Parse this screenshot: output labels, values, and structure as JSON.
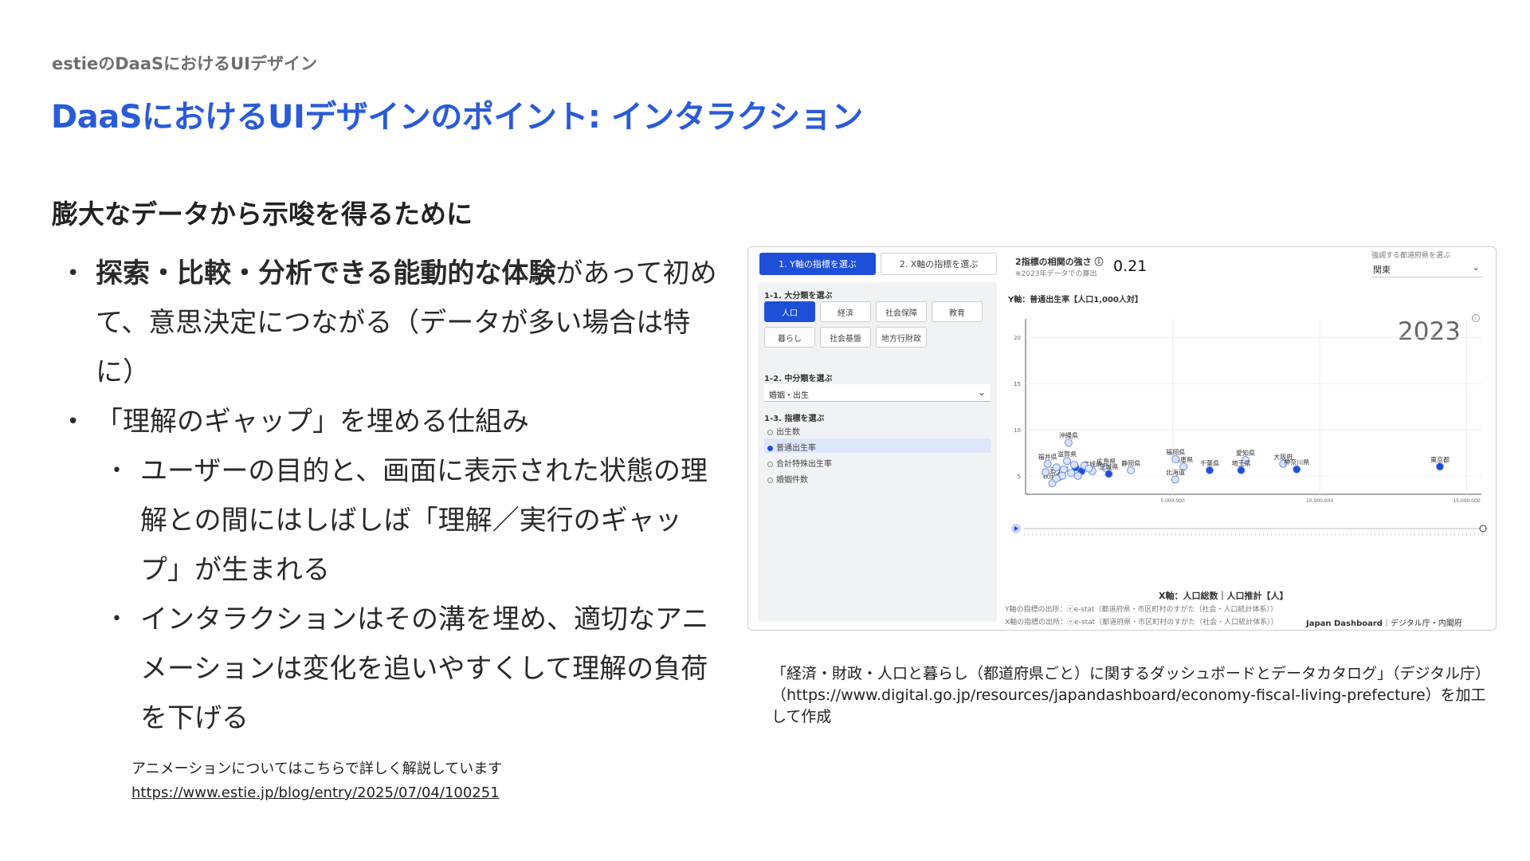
{
  "header": {
    "kicker": "estieのDaaSにおけるUIデザイン",
    "title": "DaaSにおけるUIデザインのポイント: インタラクション"
  },
  "section_heading": "膨大なデータから示唆を得るために",
  "bullets": {
    "b1_strong": "探索・比較・分析できる能動的な体験",
    "b1_rest": "があって初めて、意思決定につながる（データが多い場合は特に）",
    "b2": "「理解のギャップ」を埋める仕組み",
    "b2_1": "ユーザーの目的と、画面に表示された状態の理解との間にはしばしば「理解／実行のギャップ」が生まれる",
    "b2_2": "インタラクションはその溝を埋め、適切なアニメーションは変化を追いやすくして理解の負荷を下げる"
  },
  "note": {
    "text": "アニメーションについてはこちらで詳しく解説しています",
    "link": "https://www.estie.jp/blog/entry/2025/07/04/100251"
  },
  "dashboard": {
    "tab1": "1. Y軸の指標を選ぶ",
    "tab2": "2. X軸の指標を選ぶ",
    "corr_label": "2指標の相関の強さ ⓘ",
    "corr_note": "※2023年データでの算出",
    "corr_value": "0.21",
    "pref_label": "強調する都道府県を選ぶ",
    "pref_value": "関東",
    "s11": "1-1. 大分類を選ぶ",
    "chips": [
      "人口",
      "経済",
      "社会保障",
      "教育",
      "暮らし",
      "社会基盤",
      "地方行財政"
    ],
    "s12": "1-2. 中分類を選ぶ",
    "mid_value": "婚姻・出生",
    "s13": "1-3. 指標を選ぶ",
    "radios": [
      "出生数",
      "普通出生率",
      "合計特殊出生率",
      "婚姻件数"
    ],
    "y_title": "Y軸：普通出生率【人口1,000人対】",
    "year": "2023",
    "x_title": "X軸：人口総数｜人口推計【人】",
    "src_y": "Y軸の指標の出所：ⓔe-stat（都道府県・市区町村のすがた（社会・人口統計体系））",
    "src_x": "X軸の指標の出所：ⓔe-stat（都道府県・市区町村のすがた（社会・人口統計体系））",
    "brand_strong": "Japan Dashboard",
    "brand_rest": "｜デジタル庁・内閣府"
  },
  "chart_data": {
    "type": "scatter",
    "xlabel": "X軸：人口総数｜人口推計【人】",
    "ylabel": "Y軸：普通出生率【人口1,000人対】",
    "y_ticks": [
      "5",
      "10",
      "15",
      "20"
    ],
    "x_ticks": [
      "5,000,000",
      "10,000,000",
      "15,000,000"
    ],
    "ylim": [
      3,
      22
    ],
    "xlim": [
      0,
      15500000
    ],
    "points": [
      {
        "label": "沖縄県",
        "x": 1460000,
        "y": 8.6,
        "highlight": false
      },
      {
        "label": "福井県",
        "x": 750000,
        "y": 6.3,
        "highlight": false
      },
      {
        "label": "滋賀県",
        "x": 1410000,
        "y": 6.6,
        "highlight": false
      },
      {
        "label": "宮城県",
        "x": 2270000,
        "y": 5.5,
        "highlight": false
      },
      {
        "label": "静岡県",
        "x": 3580000,
        "y": 5.6,
        "highlight": false
      },
      {
        "label": "広島県",
        "x": 2740000,
        "y": 5.8,
        "highlight": false
      },
      {
        "label": "茨城県",
        "x": 2830000,
        "y": 5.2,
        "highlight": true
      },
      {
        "label": "岩手県",
        "x": 1160000,
        "y": 4.9,
        "highlight": false
      },
      {
        "label": "秋田県",
        "x": 910000,
        "y": 4.2,
        "highlight": false
      },
      {
        "label": "兵庫県",
        "x": 5370000,
        "y": 6.0,
        "highlight": false
      },
      {
        "label": "福岡県",
        "x": 5100000,
        "y": 6.8,
        "highlight": false
      },
      {
        "label": "北海道",
        "x": 5090000,
        "y": 4.6,
        "highlight": false
      },
      {
        "label": "千葉県",
        "x": 6260000,
        "y": 5.6,
        "highlight": true
      },
      {
        "label": "愛知県",
        "x": 7480000,
        "y": 6.7,
        "highlight": false
      },
      {
        "label": "埼玉県",
        "x": 7330000,
        "y": 5.6,
        "highlight": true
      },
      {
        "label": "大阪府",
        "x": 8760000,
        "y": 6.3,
        "highlight": false
      },
      {
        "label": "神奈川県",
        "x": 9220000,
        "y": 5.7,
        "highlight": true
      },
      {
        "label": "東京都",
        "x": 14090000,
        "y": 6.0,
        "highlight": true
      },
      {
        "label": "",
        "x": 1050000,
        "y": 5.9,
        "highlight": false
      },
      {
        "label": "",
        "x": 1300000,
        "y": 5.7,
        "highlight": false
      },
      {
        "label": "",
        "x": 1700000,
        "y": 5.9,
        "highlight": true
      },
      {
        "label": "",
        "x": 1900000,
        "y": 5.5,
        "highlight": true
      },
      {
        "label": "",
        "x": 1550000,
        "y": 5.3,
        "highlight": false
      },
      {
        "label": "",
        "x": 1780000,
        "y": 5.0,
        "highlight": false
      },
      {
        "label": "",
        "x": 2000000,
        "y": 6.1,
        "highlight": false
      },
      {
        "label": "",
        "x": 1250000,
        "y": 5.0,
        "highlight": false
      },
      {
        "label": "",
        "x": 2150000,
        "y": 5.8,
        "highlight": false
      },
      {
        "label": "",
        "x": 1650000,
        "y": 6.2,
        "highlight": false
      },
      {
        "label": "",
        "x": 680000,
        "y": 5.4,
        "highlight": false
      },
      {
        "label": "",
        "x": 1050000,
        "y": 4.7,
        "highlight": false
      }
    ]
  },
  "colors": {
    "accent": "#2a5bd7",
    "dashboard_primary": "#1d4fd8"
  }
}
